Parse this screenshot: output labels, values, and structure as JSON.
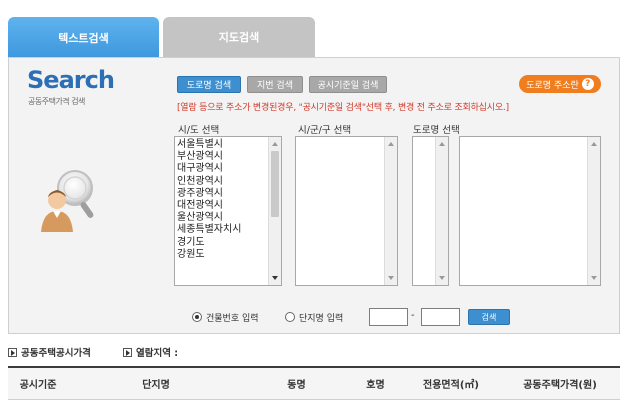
{
  "tabs": [
    {
      "label": "텍스트검색",
      "active": true
    },
    {
      "label": "지도검색",
      "active": false
    }
  ],
  "logo": {
    "title": "Search",
    "subtitle": "공동주택가격 검색"
  },
  "search_buttons": {
    "road": "도로명 검색",
    "lot": "지번 검색",
    "date": "공시기준일 검색"
  },
  "road_address_button": {
    "label": "도로명 주소란",
    "help": "?"
  },
  "notice": "[열람 등으로 주소가 변경된경우, \"공시기준일 검색\"선택 후, 변경 전 주소로 조회하십시오.]",
  "columns": {
    "sido": "시/도 선택",
    "sigungu": "시/군/구 선택",
    "road": "도로명 선택"
  },
  "sido_options": [
    "서울특별시",
    "부산광역시",
    "대구광역시",
    "인천광역시",
    "광주광역시",
    "대전광역시",
    "울산광역시",
    "세종특별자치시",
    "경기도",
    "강원도"
  ],
  "radios": {
    "building_no": "건물번호 입력",
    "complex_name": "단지명 입력",
    "selected": "building_no"
  },
  "range": {
    "separator": "-",
    "search_button": "검색"
  },
  "info": {
    "price_label": "공동주택공시가격",
    "area_label": "열람지역 :"
  },
  "table_headers": [
    "공시기준",
    "단지명",
    "동명",
    "호명",
    "전용면적(㎡)",
    "공동주택가격(원)"
  ],
  "colors": {
    "accent_blue": "#3d8fcf",
    "notice_red": "#d23a2a",
    "orange": "#f07d1e"
  }
}
